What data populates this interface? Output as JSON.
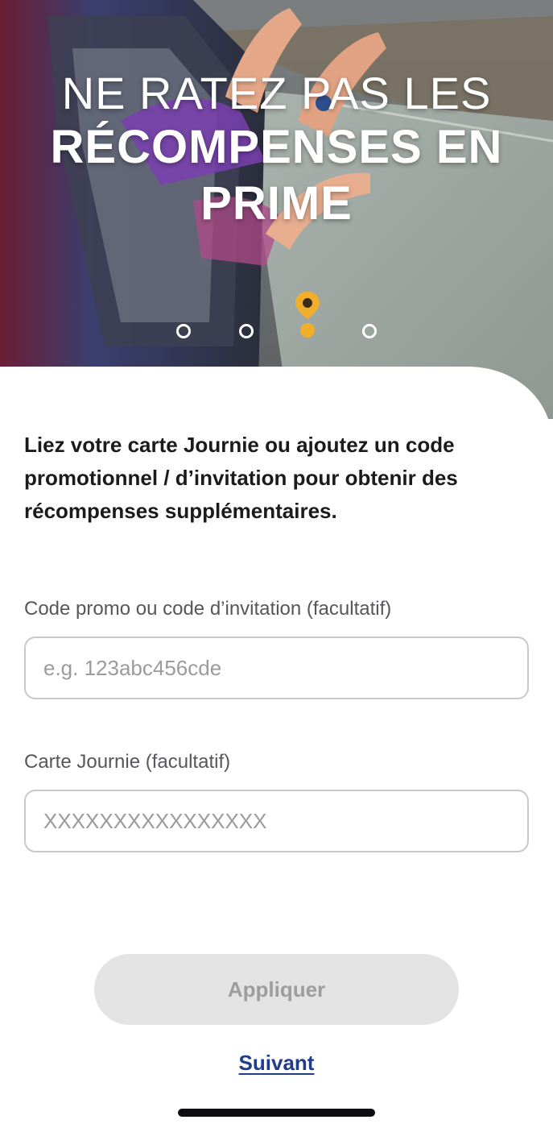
{
  "hero": {
    "line1": "NE RATEZ PAS LES",
    "line2": "RÉCOMPENSES EN",
    "line3": "PRIME"
  },
  "pager": {
    "total": 4,
    "active_index": 3,
    "active_icon": "location-pin-icon",
    "accent_color": "#f0ae2b"
  },
  "intro": "Liez votre carte Journie ou ajoutez un code promotionnel / d’invitation pour obtenir des récompenses supplémentaires.",
  "form": {
    "promo_label": "Code promo ou code d’invitation (facultatif)",
    "promo_placeholder": "e.g. 123abc456cde",
    "promo_value": "",
    "card_label": "Carte Journie (facultatif)",
    "card_placeholder": "XXXXXXXXXXXXXXXX",
    "card_value": ""
  },
  "actions": {
    "apply_label": "Appliquer",
    "next_label": "Suivant"
  },
  "colors": {
    "link": "#1f3d8c",
    "button_disabled_bg": "#e3e3e3",
    "button_disabled_text": "#9d9d9f"
  }
}
